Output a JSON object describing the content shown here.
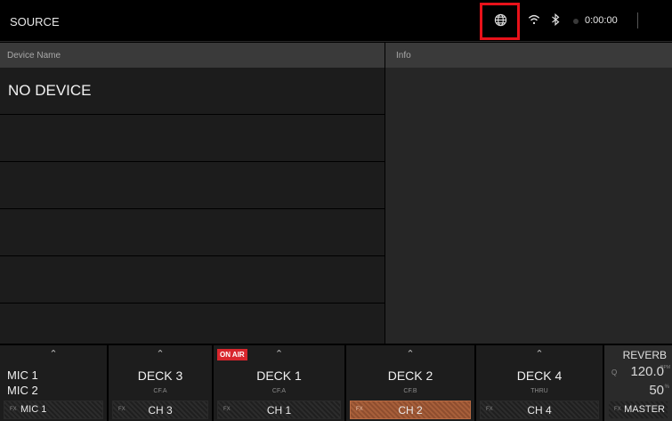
{
  "header": {
    "title": "SOURCE",
    "globe_icon": "globe-icon",
    "wifi_icon": "wifi-icon",
    "bluetooth_icon": "bluetooth-icon",
    "time": "0:00:00",
    "highlight_color": "#e8121a"
  },
  "device_list": {
    "column_header": "Device Name",
    "rows": [
      "NO DEVICE",
      "",
      "",
      "",
      "",
      ""
    ]
  },
  "info_panel": {
    "column_header": "Info"
  },
  "mixer": {
    "mic": {
      "chevron": "^",
      "line1": "MIC 1",
      "line2": "MIC 2",
      "fx": "FX",
      "channel": "MIC 1"
    },
    "decks": [
      {
        "chevron": "^",
        "name": "DECK 3",
        "crossfader": "CF.A",
        "fx": "FX",
        "channel": "CH 3",
        "on_air": false,
        "active": false
      },
      {
        "chevron": "^",
        "name": "DECK 1",
        "crossfader": "CF.A",
        "fx": "FX",
        "channel": "CH 1",
        "on_air": true,
        "on_air_label": "ON AIR",
        "active": false
      },
      {
        "chevron": "^",
        "name": "DECK 2",
        "crossfader": "CF.B",
        "fx": "FX",
        "channel": "CH 2",
        "on_air": false,
        "active": true
      },
      {
        "chevron": "^",
        "name": "DECK 4",
        "crossfader": "THRU",
        "fx": "FX",
        "channel": "CH 4",
        "on_air": false,
        "active": false
      }
    ],
    "effect": {
      "name": "REVERB",
      "q_label": "Q",
      "bpm": "120.0",
      "bpm_unit": "BPM",
      "level": "50",
      "level_unit": "%",
      "fx": "FX",
      "channel": "MASTER"
    },
    "active_color": "#a75f3a",
    "on_air_color": "#d8262d"
  }
}
